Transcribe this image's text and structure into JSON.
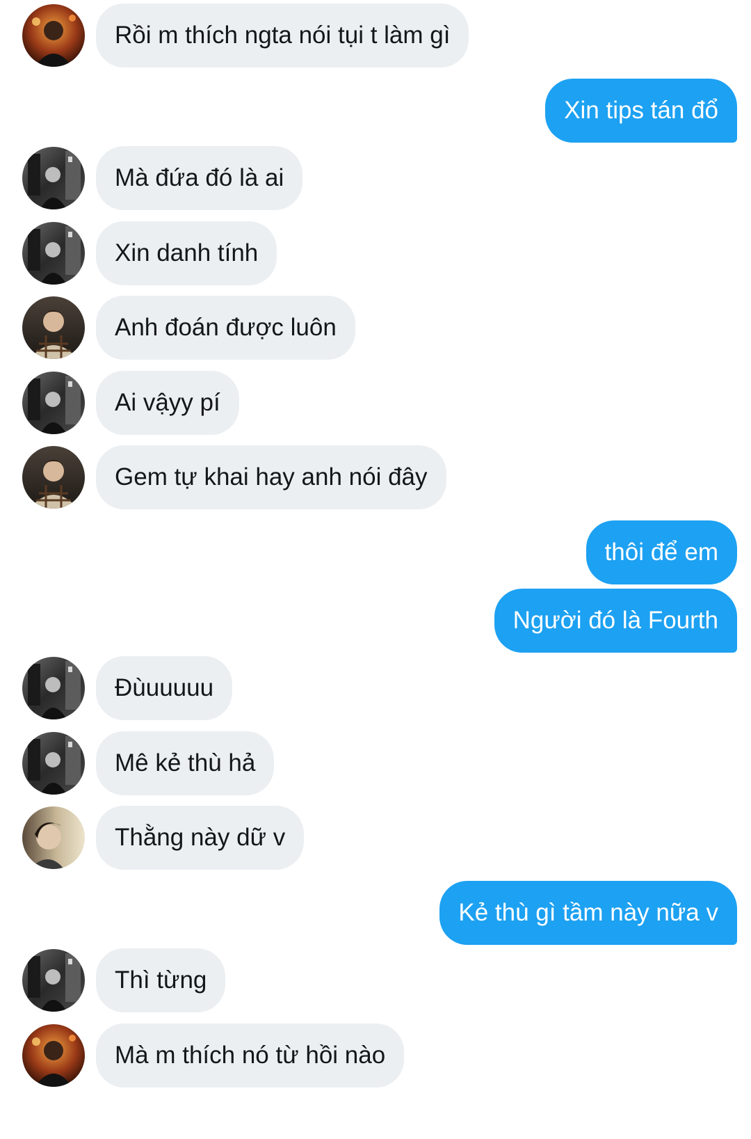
{
  "colors": {
    "incoming_bubble": "#eceff2",
    "outgoing_bubble": "#1da1f2",
    "incoming_text": "#14171a",
    "outgoing_text": "#ffffff"
  },
  "messages": [
    {
      "side": "in",
      "avatar": "avatar-neon",
      "text": "Rồi m thích ngta nói tụi t làm gì"
    },
    {
      "side": "out",
      "text": "Xin tips tán đổ"
    },
    {
      "side": "in",
      "avatar": "avatar-street",
      "text": "Mà đứa đó là ai"
    },
    {
      "side": "in",
      "avatar": "avatar-street",
      "text": "Xin danh tính"
    },
    {
      "side": "in",
      "avatar": "avatar-plaid",
      "text": "Anh đoán được luôn"
    },
    {
      "side": "in",
      "avatar": "avatar-street",
      "text": "Ai vậyy pí"
    },
    {
      "side": "in",
      "avatar": "avatar-plaid",
      "text": "Gem tự khai hay anh nói đây"
    },
    {
      "side": "out",
      "text": "thôi để em"
    },
    {
      "side": "out",
      "text": "Người đó là Fourth"
    },
    {
      "side": "in",
      "avatar": "avatar-street",
      "text": "Đùuuuuu"
    },
    {
      "side": "in",
      "avatar": "avatar-street",
      "text": "Mê kẻ thù hả"
    },
    {
      "side": "in",
      "avatar": "avatar-portrait",
      "text": "Thằng này dữ v"
    },
    {
      "side": "out",
      "text": "Kẻ thù gì tầm này nữa v"
    },
    {
      "side": "in",
      "avatar": "avatar-street",
      "text": "Thì từng"
    },
    {
      "side": "in",
      "avatar": "avatar-neon",
      "text": "Mà m thích nó từ hồi nào"
    }
  ]
}
